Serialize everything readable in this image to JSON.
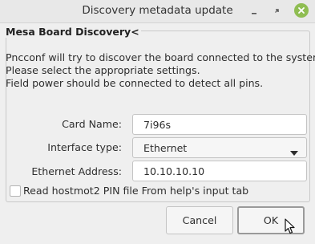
{
  "window": {
    "title": "Discovery metadata update",
    "controls": [
      "minimize-icon",
      "maximize-icon",
      "close-icon"
    ],
    "accent_color": "#8fbd52"
  },
  "frame": {
    "label": "Mesa Board Discovery<",
    "description": [
      "Pncconf will try to discover the board connected to the system.",
      "Please select the appropriate settings.",
      "Field power should be connected to detect all pins."
    ]
  },
  "form": {
    "card_name": {
      "label": "Card Name:",
      "value": "7i96s"
    },
    "interface_type": {
      "label": "Interface type:",
      "value": "Ethernet"
    },
    "ethernet_address": {
      "label": "Ethernet Address:",
      "value": "10.10.10.10"
    }
  },
  "checkbox": {
    "label": "Read hostmot2 PIN file From help's input tab",
    "checked": false
  },
  "buttons": {
    "cancel": "Cancel",
    "ok": "OK"
  }
}
